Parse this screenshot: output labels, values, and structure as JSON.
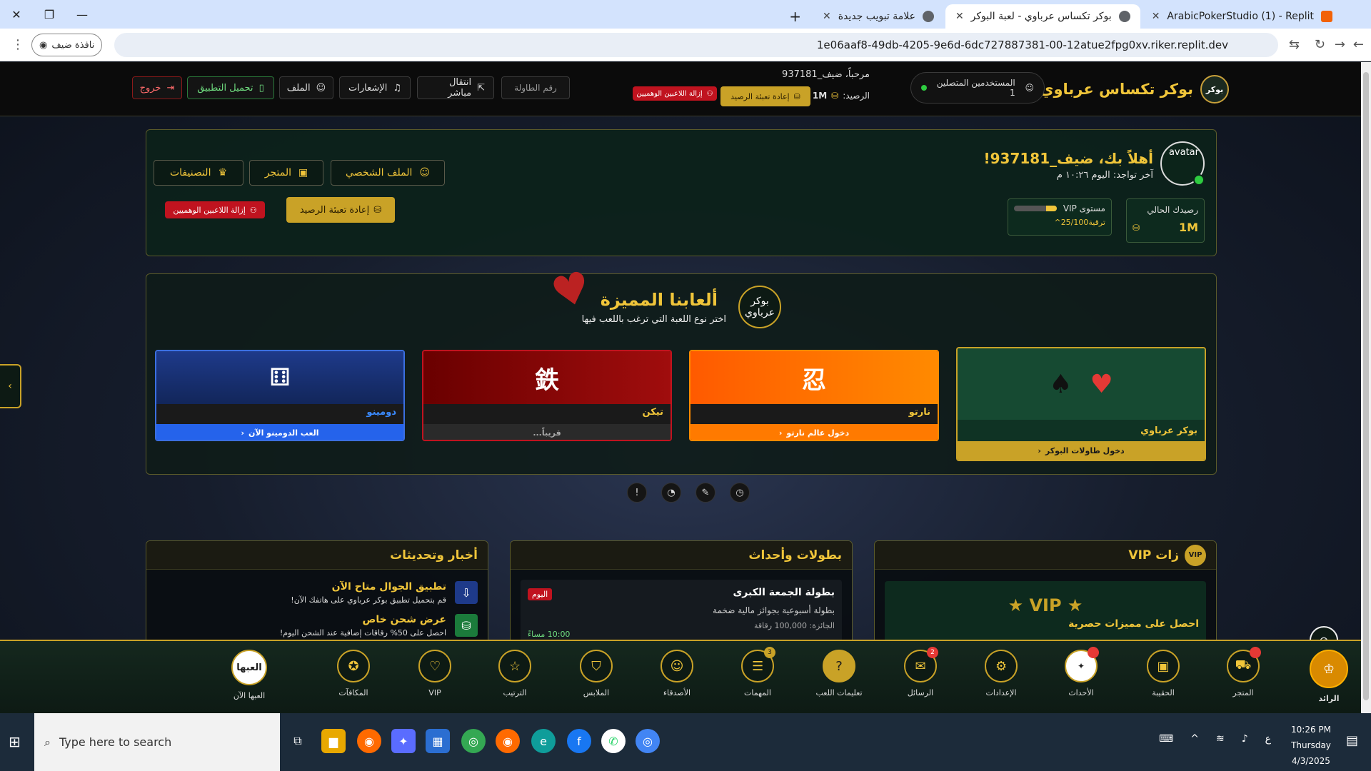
{
  "browser": {
    "tabs": [
      {
        "label": "ArabicPokerStudio (1) - Replit",
        "active": false
      },
      {
        "label": "بوكر تكساس عرباوي - لعبة البوكر",
        "active": true
      },
      {
        "label": "علامة تبويب جديدة",
        "active": false
      }
    ],
    "url": "1e06aaf8-49db-4205-9e6d-6dc727887381-00-12atue2fpg0xv.riker.replit.dev",
    "guest_label": "نافذة ضيف"
  },
  "topnav": {
    "brand_title": "بوكر تكساس عرباوي",
    "logo_alt": "بوكر",
    "online_label": "المستخدمين المتصلين",
    "online_count": "1",
    "welcome": "مرحباً، ضيف_937181",
    "balance_label": "الرصيد:",
    "balance_value": "1M",
    "refill_btn": "إعادة تعبئة الرصيد",
    "remove_bots_btn": "إزالة اللاعبين الوهميين",
    "table_input_placeholder": "رقم الطاولة",
    "live_btn": "انتقال مباشر",
    "notif_btn": "الإشعارات",
    "profile_btn": "الملف",
    "download_btn": "تحميل التطبيق",
    "logout_btn": "خروج"
  },
  "profile_panel": {
    "hello": "أهلاً بك، ضيف_937181!",
    "last_seen": "آخر تواجد: اليوم ١٠:٢٦ م",
    "avatar_alt": "avatar",
    "profile_btn": "الملف الشخصي",
    "shop_btn": "المتجر",
    "ranking_btn": "التصنيفات",
    "refill_btn": "إعادة تعبئة الرصيد",
    "remove_bots_btn": "إزالة اللاعبين الوهميين",
    "balance_label": "رصيدك الحالي",
    "balance_value": "1M",
    "vip_label": "مستوى VIP",
    "vip_progress_text": "25/100",
    "vip_upgrade": "ترقية",
    "vip_progress": 0.25
  },
  "games_section": {
    "title": "ألعابنا المميزة",
    "subtitle": "اختر نوع اللعبة التي ترغب باللعب فيها",
    "logo_alt": "بوكر عرباوي",
    "games": [
      {
        "name": "بوكر عرباوي",
        "action": "دخول طاولات البوكر",
        "symbol": "♥ ♠"
      },
      {
        "name": "نارتو",
        "action": "دخول عالم نارتو",
        "symbol": "忍"
      },
      {
        "name": "تيكن",
        "action": "قريباً...",
        "symbol": "鉄"
      },
      {
        "name": "دومينو",
        "action": "العب الدومينو الآن",
        "symbol": "⚅"
      }
    ]
  },
  "cards": {
    "vip": {
      "title": "زات VIP",
      "badge": "VIP",
      "banner": "★ VIP ★",
      "sub": "احصل على مميزات حصرية"
    },
    "events": {
      "title": "بطولات وأحداث",
      "event_title": "بطولة الجمعة الكبرى",
      "event_desc": "بطولة أسبوعية بجوائز مالية ضخمة",
      "prize": "الجائزة: 100,000 رقاقة",
      "tag": "اليوم",
      "time": "10:00 مساءً"
    },
    "news": {
      "title": "أخبار وتحديثات",
      "items": [
        {
          "title": "تطبيق الجوال متاح الآن",
          "desc": "قم بتحميل تطبيق بوكر عرباوي على هاتفك الآن!"
        },
        {
          "title": "عرض شحن خاص",
          "desc": "احصل على 50% رقاقات إضافية عند الشحن اليوم!"
        }
      ]
    }
  },
  "bottom_nav": [
    {
      "label": "الرائد",
      "icon": "rank-badge-icon"
    },
    {
      "label": "المتجر",
      "icon": "cart-icon",
      "badge": ""
    },
    {
      "label": "الحقيبة",
      "icon": "bag-icon"
    },
    {
      "label": "الأحداث",
      "icon": "events-icon",
      "badge": ""
    },
    {
      "label": "الإعدادات",
      "icon": "gear-icon"
    },
    {
      "label": "الرسائل",
      "icon": "mail-icon",
      "badge": "2"
    },
    {
      "label": "تعليمات اللعب",
      "icon": "help-icon"
    },
    {
      "label": "المهمات",
      "icon": "tasks-icon",
      "badge": "3"
    },
    {
      "label": "الأصدقاء",
      "icon": "friends-icon"
    },
    {
      "label": "الملابس",
      "icon": "shirt-icon"
    },
    {
      "label": "الترتيب",
      "icon": "star-icon"
    },
    {
      "label": "VIP",
      "icon": "heart-icon"
    },
    {
      "label": "المكافآت",
      "icon": "award-icon"
    },
    {
      "label": "العبها الآن",
      "icon": "play-now-icon",
      "icon_text": "العبها"
    }
  ],
  "taskbar": {
    "search_placeholder": "Type here to search",
    "time": "10:26 PM",
    "day": "Thursday",
    "date": "4/3/2025",
    "lang": "ع"
  },
  "colors": {
    "gold": "#f0c53a",
    "poker_green": "#0d2a1e",
    "naruto_orange": "#ff7a00",
    "tekken_red": "#8b0a0a",
    "domino_blue": "#1e3a8a"
  }
}
